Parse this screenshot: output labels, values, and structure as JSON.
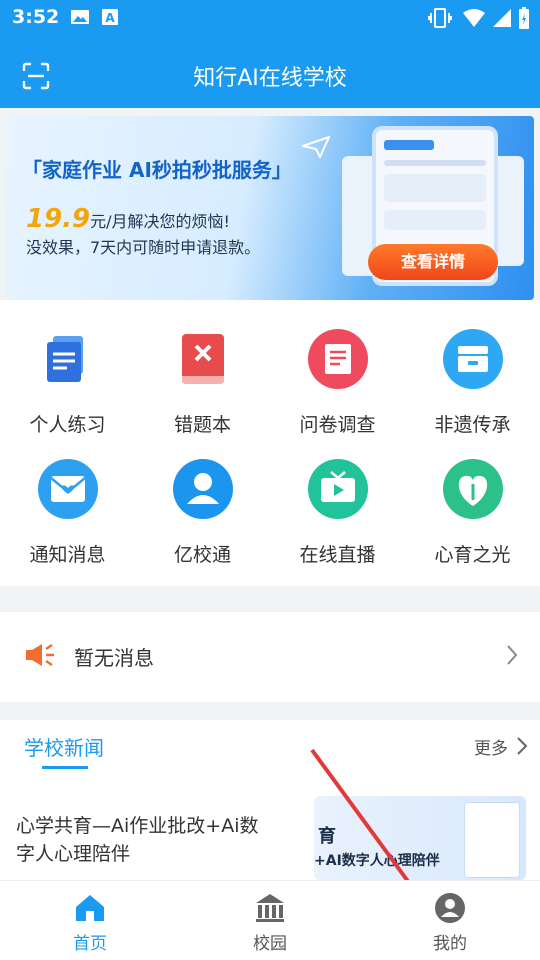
{
  "status_bar": {
    "time": "3:52"
  },
  "app_bar": {
    "title": "知行AI在线学校",
    "scan_icon": "scan-icon"
  },
  "banner": {
    "headline": "「家庭作业  AI秒拍秒批服务」",
    "price": "19.9",
    "price_suffix": "元/月解决您的烦恼!",
    "line3": "没效果，7天内可随时申请退款。",
    "cta": "查看详情"
  },
  "grid": {
    "items": [
      {
        "label": "个人练习",
        "icon": "document-icon",
        "color": "#3a7fe6"
      },
      {
        "label": "错题本",
        "icon": "book-x-icon",
        "color": "#e84b4b"
      },
      {
        "label": "问卷调查",
        "icon": "certificate-icon",
        "color": "#f04a5e"
      },
      {
        "label": "非遗传承",
        "icon": "cabinet-icon",
        "color": "#2ea8f5"
      },
      {
        "label": "通知消息",
        "icon": "envelope-heart-icon",
        "color": "#2ea0f0"
      },
      {
        "label": "亿校通",
        "icon": "user-icon",
        "color": "#1c95ee"
      },
      {
        "label": "在线直播",
        "icon": "tv-play-icon",
        "color": "#22c29a"
      },
      {
        "label": "心育之光",
        "icon": "heart-leaf-icon",
        "color": "#2cc08a"
      }
    ]
  },
  "notice": {
    "text": "暂无消息"
  },
  "news": {
    "tab": "学校新闻",
    "more": "更多",
    "article_title": "心学共育—Ai作业批改+Ai数字人心理陪伴",
    "thumb_text1": "育",
    "thumb_text2": "+AI数字人心理陪伴"
  },
  "tabbar": {
    "items": [
      {
        "label": "首页",
        "icon": "home-icon"
      },
      {
        "label": "校园",
        "icon": "campus-icon"
      },
      {
        "label": "我的",
        "icon": "profile-icon"
      }
    ],
    "active_color": "#1a9af0"
  }
}
